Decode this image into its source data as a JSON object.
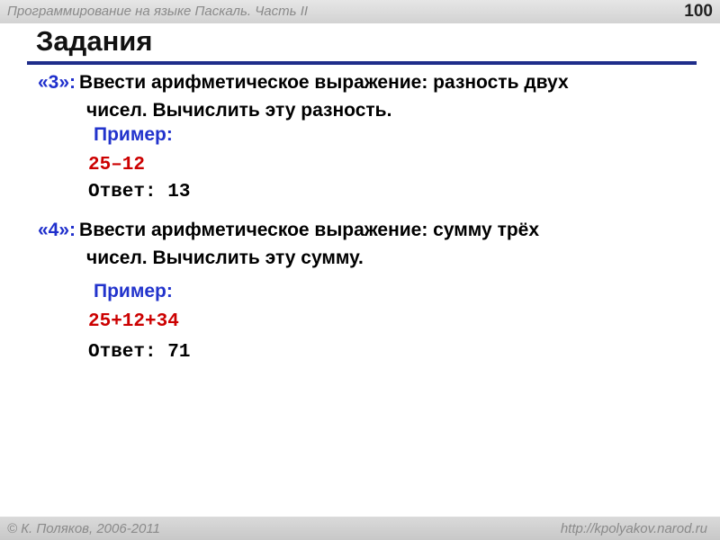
{
  "header": {
    "course_title": "Программирование на языке Паскаль. Часть II",
    "page_number": "100"
  },
  "slide": {
    "title": "Задания"
  },
  "tasks": [
    {
      "number": "«3»:",
      "line1": "Ввести арифметическое выражение: разность двух",
      "line2": "чисел. Вычислить эту разность.",
      "example_label": "Пример:",
      "expression": "25–12",
      "answer": "Ответ: 13"
    },
    {
      "number": "«4»:",
      "line1": "Ввести арифметическое выражение: сумму трёх",
      "line2": "чисел. Вычислить эту сумму.",
      "example_label": "Пример:",
      "expression": "25+12+34",
      "answer": "Ответ: 71"
    }
  ],
  "footer": {
    "copyright": "© К. Поляков, 2006-2011",
    "url": "http://kpolyakov.narod.ru"
  },
  "colors": {
    "accent_blue": "#1f2fcc",
    "rule_blue": "#1f2d8a",
    "expression_red": "#cc0000"
  }
}
